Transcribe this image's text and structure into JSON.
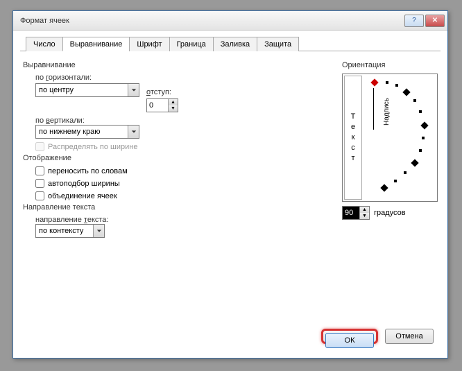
{
  "window": {
    "title": "Формат ячеек"
  },
  "tabs": [
    "Число",
    "Выравнивание",
    "Шрифт",
    "Граница",
    "Заливка",
    "Защита"
  ],
  "active_tab": 1,
  "alignment": {
    "group": "Выравнивание",
    "horizontal_label": "по горизонтали:",
    "horizontal_value": "по центру",
    "indent_label": "отступ:",
    "indent_value": "0",
    "vertical_label": "по вертикали:",
    "vertical_value": "по нижнему краю",
    "distribute_label": "Распределять по ширине"
  },
  "display": {
    "group": "Отображение",
    "wrap": "переносить по словам",
    "shrink": "автоподбор ширины",
    "merge": "объединение ячеек"
  },
  "textdir": {
    "group": "Направление текста",
    "label": "направление текста:",
    "value": "по контексту"
  },
  "orientation": {
    "group": "Ориентация",
    "vtext": [
      "Т",
      "е",
      "к",
      "с",
      "т"
    ],
    "label": "Надпись",
    "degrees_value": "90",
    "degrees_label": "градусов"
  },
  "buttons": {
    "ok": "ОК",
    "cancel": "Отмена"
  }
}
